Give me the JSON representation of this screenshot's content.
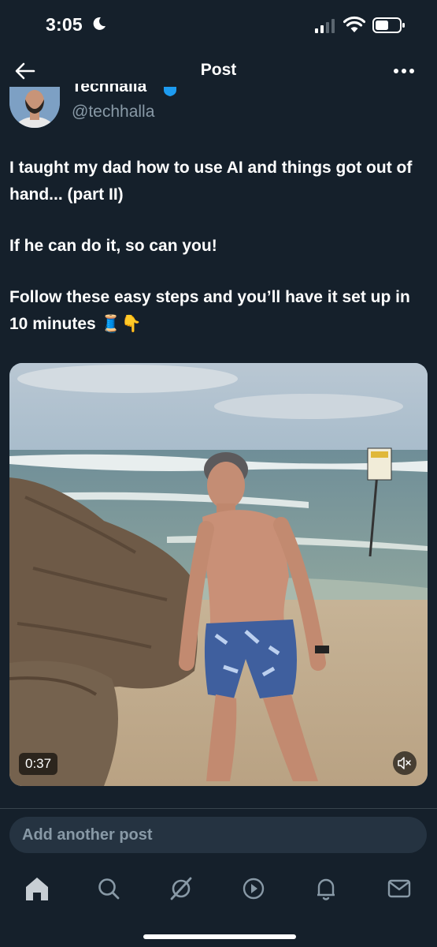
{
  "status_bar": {
    "time": "3:05",
    "icons": [
      "moon-icon",
      "cellular-signal-icon",
      "wifi-icon",
      "battery-icon"
    ]
  },
  "header": {
    "title": "Post",
    "back_icon": "back-arrow-icon",
    "more_icon": "more-icon"
  },
  "author": {
    "display_name": "Techhalla",
    "handle": "@techhalla",
    "verified": true
  },
  "post": {
    "paragraphs": [
      "I taught my dad how to use AI and things got out of hand... (part II)",
      "If he can do it, so can you!",
      "Follow these easy steps and you’ll have it set up in 10 minutes 🧵👇"
    ],
    "video": {
      "duration": "0:37",
      "muted": true
    }
  },
  "reply": {
    "placeholder": "Add another post"
  },
  "tab_bar": {
    "items": [
      "home-icon",
      "search-icon",
      "grok-icon",
      "video-icon",
      "notifications-icon",
      "messages-icon"
    ],
    "active": "home-icon"
  },
  "colors": {
    "background": "#15202b",
    "secondary_text": "#8899a6",
    "verified": "#1d9bf0",
    "reply_box": "#253341"
  }
}
